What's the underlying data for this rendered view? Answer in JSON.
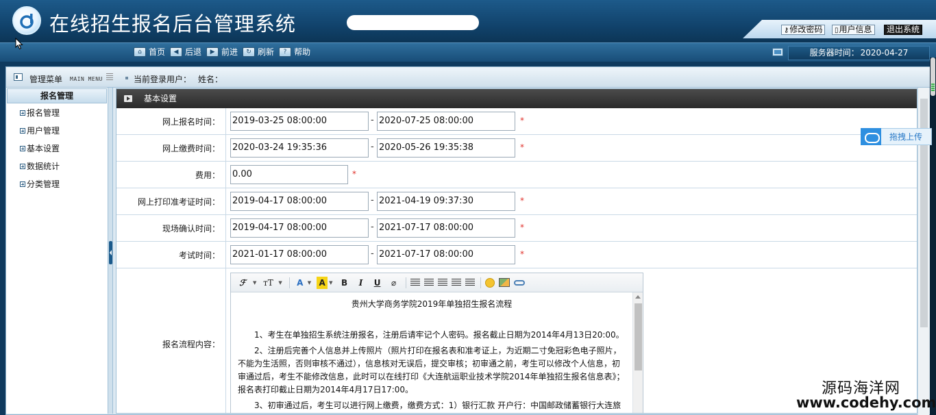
{
  "app": {
    "title": "在线招生报名后台管理系统",
    "top_links": [
      {
        "label": "修改密码",
        "icon": "key-icon"
      },
      {
        "label": "用户信息",
        "icon": "user-icon"
      },
      {
        "label": "退出系统"
      }
    ]
  },
  "toolbar": {
    "items": [
      {
        "label": "首页",
        "icon": "home-icon"
      },
      {
        "label": "后退",
        "icon": "back-arrow-icon"
      },
      {
        "label": "前进",
        "icon": "forward-arrow-icon"
      },
      {
        "label": "刷新",
        "icon": "refresh-icon"
      },
      {
        "label": "帮助",
        "icon": "help-icon"
      }
    ],
    "server_time_label": "服务器时间：",
    "server_time": "2020-04-27"
  },
  "subbar": {
    "menu_title": "管理菜单",
    "menu_sub": "MAIN MENU",
    "current_user_label": "当前登录用户：",
    "name_label": "姓名："
  },
  "sidebar": {
    "section_title": "报名管理",
    "items": [
      {
        "label": "报名管理"
      },
      {
        "label": "用户管理"
      },
      {
        "label": "基本设置"
      },
      {
        "label": "数据统计"
      },
      {
        "label": "分类管理"
      }
    ]
  },
  "panel": {
    "title": "基本设置",
    "rows": [
      {
        "label": "网上报名时间：",
        "start": "2019-03-25 08:00:00",
        "end": "2020-07-25 08:00:00"
      },
      {
        "label": "网上缴费时间：",
        "start": "2020-03-24 19:35:36",
        "end": "2020-05-26 19:35:38"
      },
      {
        "label": "费用：",
        "value": "0.00"
      },
      {
        "label": "网上打印准考证时间：",
        "start": "2019-04-17 08:00:00",
        "end": "2021-04-19 09:37:30"
      },
      {
        "label": "现场确认时间：",
        "start": "2019-04-17 08:00:00",
        "end": "2021-07-17 08:00:00"
      },
      {
        "label": "考试时间：",
        "start": "2021-01-17 08:00:00",
        "end": "2021-07-17 08:00:00"
      }
    ],
    "dash": "-",
    "required_mark": "*",
    "process_label": "报名流程内容："
  },
  "editor": {
    "heading": "贵州大学商务学院2019年单独招生报名流程",
    "paragraphs": [
      "1、考生在单独招生系统注册报名，注册后请牢记个人密码。报名截止日期为2014年4月13日20:00。",
      "2、注册后完善个人信息并上传照片（照片打印在报名表和准考证上，为近期二寸免冠彩色电子照片，不能为生活照，否则审核不通过），信息核对无误后，提交审核；初审通之前，考生可以修改个人信息，初审通过后，考生不能修改信息，此时可以在线打印《大连航运职业技术学院2014年单独招生报名信息表》；报名表打印截止日期为2014年4月17日17:00。",
      "3、初审通过后，考生可以进行网上缴费，缴费方式：1）银行汇款 开户行：中国邮政储蓄银行大连旅"
    ],
    "toolbar": {
      "font_family": "ℱ",
      "font_size": "ᴛT",
      "font_color": "A",
      "highlight": "A",
      "bold": "B",
      "italic": "I",
      "underline": "U",
      "eraser": "⌀"
    }
  },
  "upload": {
    "label": "拖拽上传"
  },
  "watermark": {
    "line1": "源码海洋网",
    "line2": "www.codehy.com"
  },
  "colors": {
    "accent": "#1d5a8a",
    "required": "#e0302a",
    "panel_header": "#333333"
  }
}
